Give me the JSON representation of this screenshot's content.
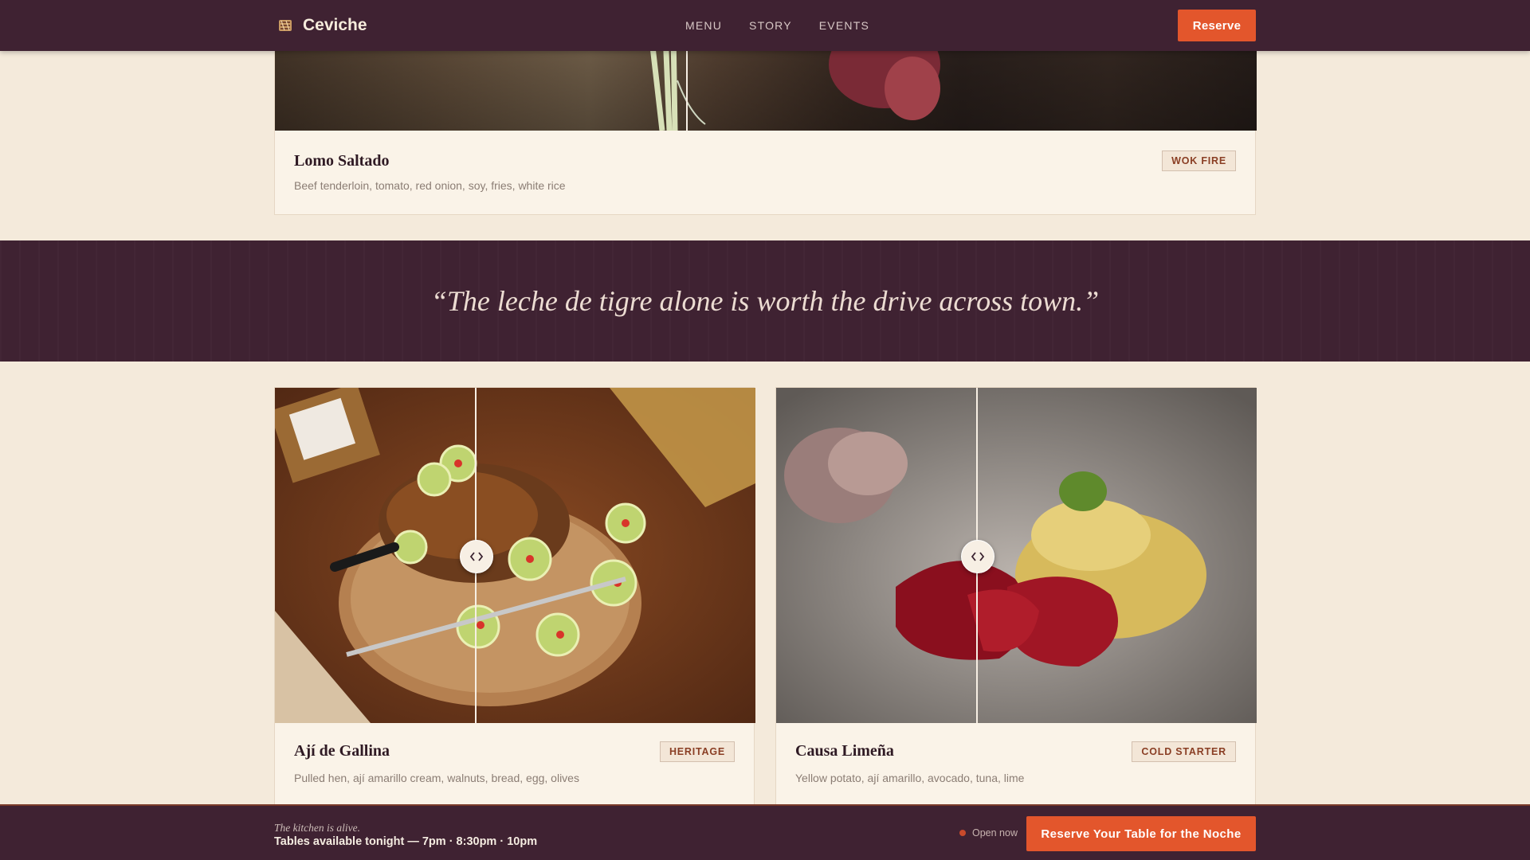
{
  "header": {
    "brand_name": "Ceviche",
    "nav": [
      "MENU",
      "STORY",
      "EVENTS"
    ],
    "reserve_label": "Reserve"
  },
  "dishes": [
    {
      "name": "Lomo Saltado",
      "badge": "WOK FIRE",
      "description": "Beef tenderloin, tomato, red onion, soy, fries, white rice"
    },
    {
      "name": "Ají de Gallina",
      "badge": "HERITAGE",
      "description": "Pulled hen, ají amarillo cream, walnuts, bread, egg, olives"
    },
    {
      "name": "Causa Limeña",
      "badge": "COLD STARTER",
      "description": "Yellow potato, ají amarillo, avocado, tuna, lime"
    }
  ],
  "quote": {
    "text": "“The leche de tigre alone is worth the drive across town.”"
  },
  "bottom_bar": {
    "tagline": "The kitchen is alive.",
    "tables": "Tables available tonight — 7pm · 8:30pm · 10pm",
    "status": "Open now",
    "cta_label": "Reserve Your Table for the Noche"
  },
  "colors": {
    "accent": "#e3562c",
    "header_bg": "#3f2232",
    "page_bg": "#f4eadb",
    "card_bg": "#faf3e8"
  },
  "icons": [
    "ceviche-logo-icon",
    "chevrons-left-right-icon",
    "status-dot-icon"
  ]
}
